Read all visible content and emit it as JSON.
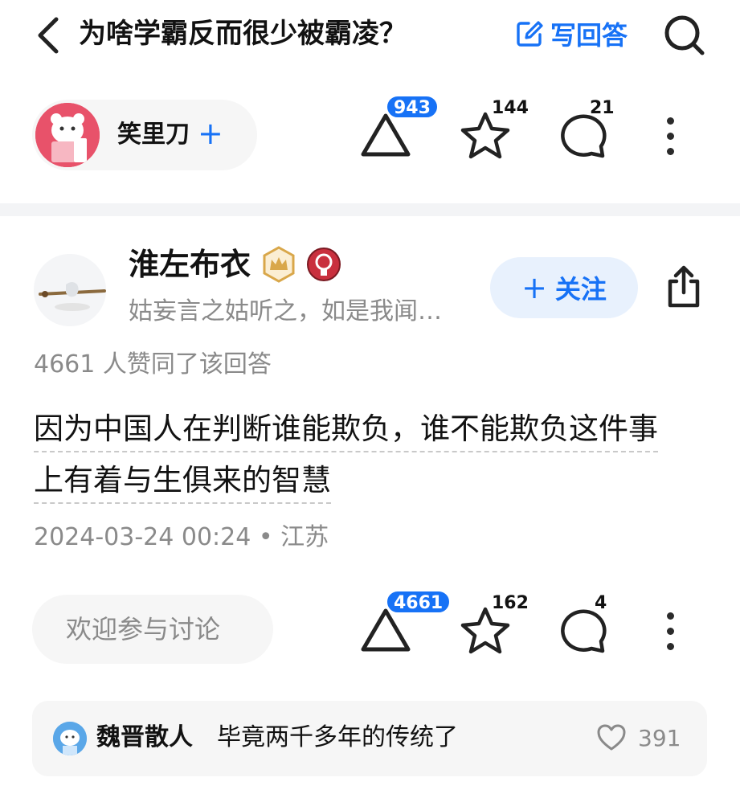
{
  "header": {
    "question_title": "为啥学霸反而很少被霸凌？",
    "write_answer_label": "写回答"
  },
  "question_bar": {
    "author_name": "笑里刀",
    "follow_symbol": "+",
    "upvote_count": "943",
    "favorite_count": "144",
    "comment_count": "21"
  },
  "answer": {
    "author_name": "淮左布衣",
    "author_bio": "姑妄言之姑听之，如是我闻…",
    "follow_label": "关注",
    "follow_symbol": "+",
    "agree_text": "4661 人赞同了该回答",
    "content_lines": [
      "因为中国人在判断谁能欺负，谁不能欺负这件事",
      "上有着与生俱来的智慧"
    ],
    "meta": "2024-03-24 00:24 • 江苏",
    "comment_placeholder": "欢迎参与讨论",
    "upvote_count": "4661",
    "favorite_count": "162",
    "comment_count": "4"
  },
  "hot_comment": {
    "author": "魏晋散人",
    "text": "毕竟两千多年的传统了",
    "like_count": "391"
  },
  "colors": {
    "accent": "#1772f6",
    "accent_light": "#e8f1fd",
    "muted_text": "#8a8a8a",
    "panel_bg": "#f6f6f6"
  },
  "icons": {
    "back": "chevron-left-icon",
    "write": "edit-icon",
    "search": "search-icon",
    "upvote": "triangle-up-icon",
    "favorite": "star-icon",
    "comment": "comment-bubble-icon",
    "more": "more-vertical-icon",
    "share": "share-icon",
    "like": "heart-icon"
  }
}
